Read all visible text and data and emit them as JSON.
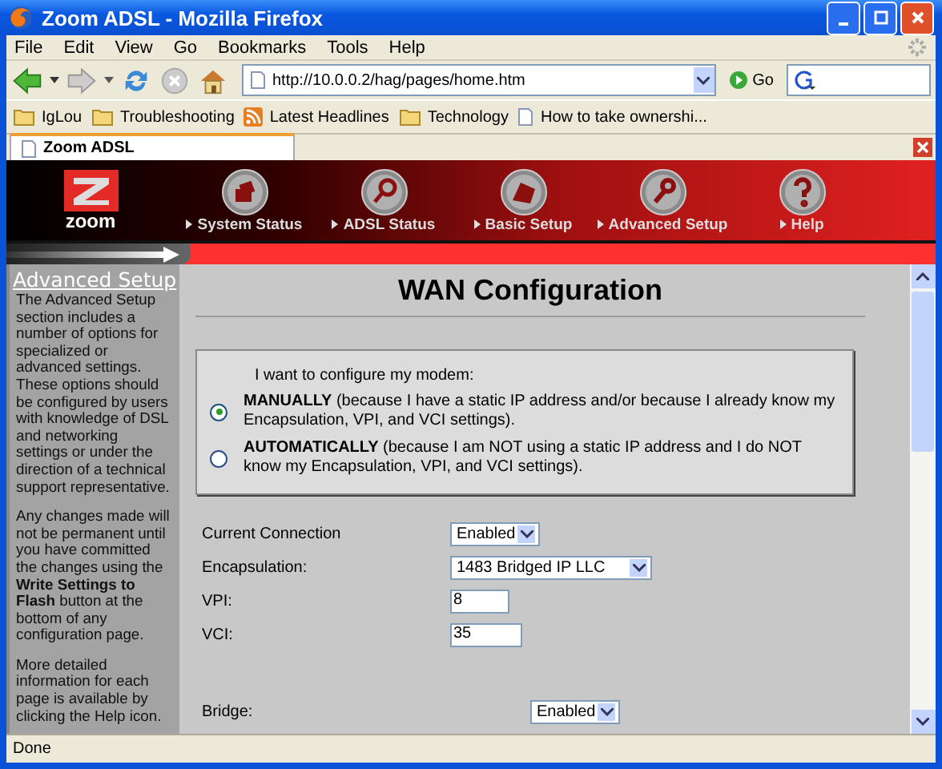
{
  "window": {
    "title": "Zoom ADSL - Mozilla Firefox"
  },
  "menu": [
    "File",
    "Edit",
    "View",
    "Go",
    "Bookmarks",
    "Tools",
    "Help"
  ],
  "address": {
    "url": "http://10.0.0.2/hag/pages/home.htm",
    "go_label": "Go"
  },
  "bookmarks": [
    {
      "label": "IgLou",
      "kind": "folder"
    },
    {
      "label": "Troubleshooting",
      "kind": "folder"
    },
    {
      "label": "Latest Headlines",
      "kind": "feed"
    },
    {
      "label": "Technology",
      "kind": "folder"
    },
    {
      "label": "How to take ownershi...",
      "kind": "page"
    }
  ],
  "tabs": [
    {
      "label": "Zoom ADSL",
      "selected": true
    }
  ],
  "header": {
    "logo_text": "zoom",
    "nav": [
      {
        "label": "System Status",
        "kind": "folders"
      },
      {
        "label": "ADSL Status",
        "kind": "magnifier"
      },
      {
        "label": "Basic Setup",
        "kind": "hand"
      },
      {
        "label": "Advanced Setup",
        "kind": "wrench"
      },
      {
        "label": "Help",
        "kind": "question"
      }
    ]
  },
  "sidebar": {
    "title": "Advanced Setup",
    "paragraphs": [
      "The Advanced Setup section includes a number of options for specialized or advanced settings. These options should be configured by users with knowledge of DSL and networking settings or under the direction of a technical support representative.",
      "Any changes made will not be permanent until you have committed the changes using the **Write Settings to Flash** button at the bottom of any configuration page.",
      "More detailed information for each page is available by clicking the Help icon."
    ]
  },
  "main": {
    "heading": "WAN Configuration",
    "intro": "I want to configure my modem:",
    "options": [
      {
        "text": "**MANUALLY** (because I have a static IP address and/or because I already know my Encapsulation, VPI, and VCI settings).",
        "selected": true
      },
      {
        "text": "**AUTOMATICALLY** (because I am NOT using a static IP address and I do NOT know my Encapsulation, VPI, and VCI settings).",
        "selected": false
      }
    ],
    "fields": [
      {
        "label": "Current Connection",
        "kind": "select",
        "value": "Enabled"
      },
      {
        "label": "Encapsulation:",
        "kind": "select",
        "value": "1483 Bridged IP LLC"
      },
      {
        "label": "VPI:",
        "kind": "input",
        "value": "8"
      },
      {
        "label": "VCI:",
        "kind": "input",
        "value": "35"
      }
    ],
    "bridge_fields": [
      {
        "label": "Bridge:",
        "kind": "select",
        "value": "Enabled"
      }
    ]
  },
  "status_bar": {
    "text": "Done"
  }
}
